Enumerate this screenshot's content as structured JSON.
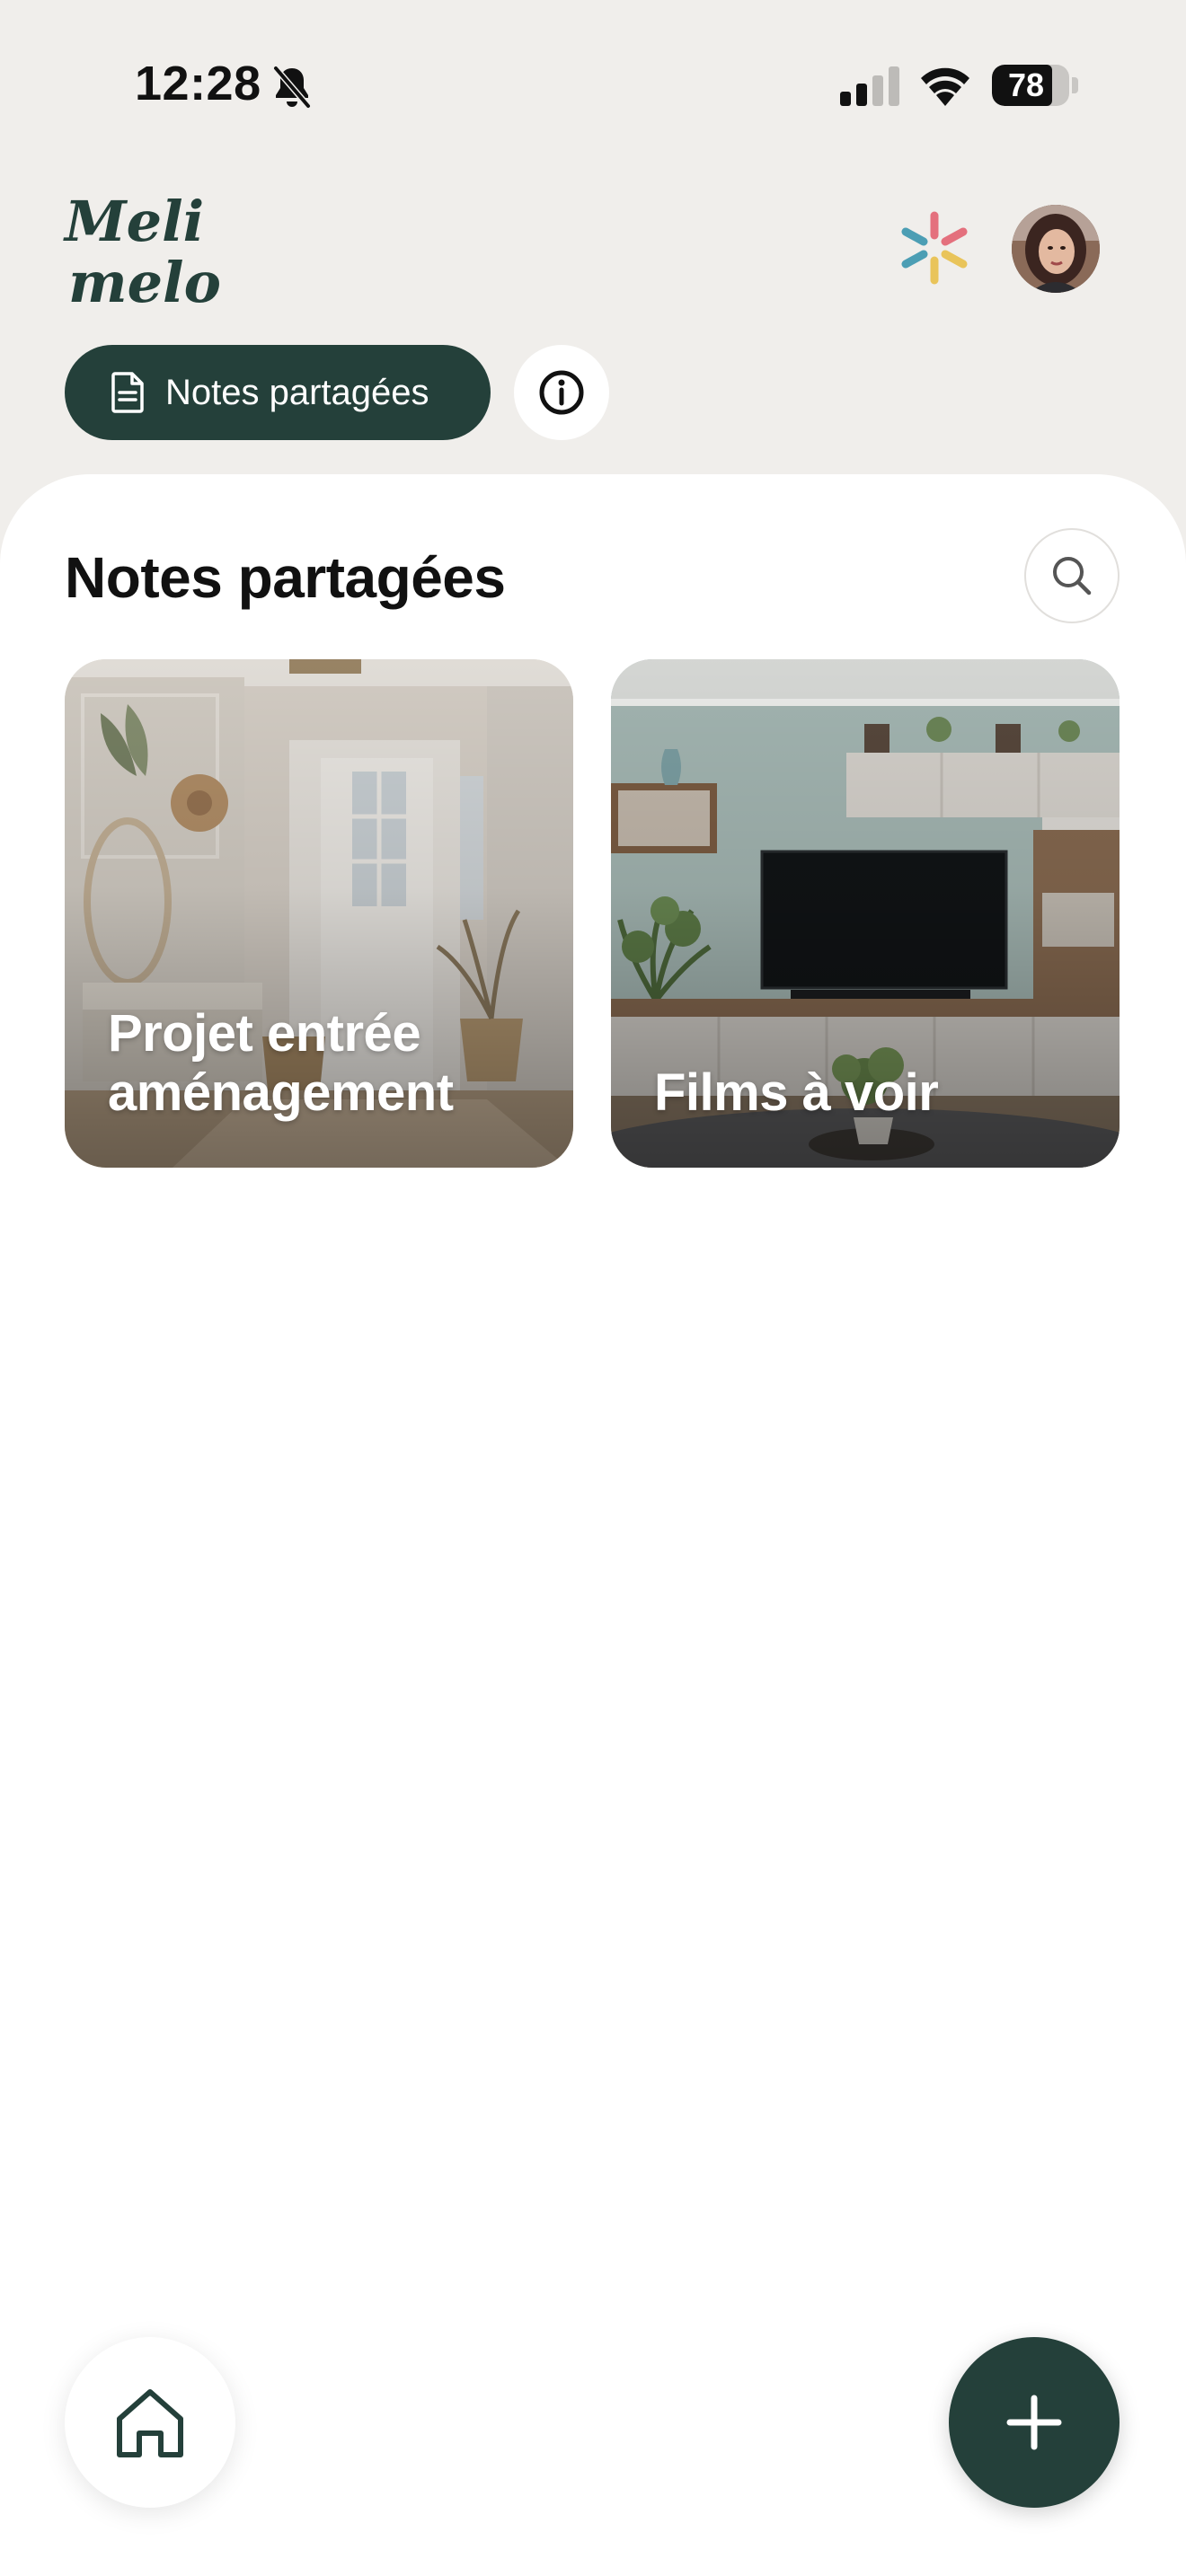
{
  "status_bar": {
    "time": "12:28",
    "silent_icon": "bell-slash-icon",
    "signal_icon": "cellular-signal-icon",
    "wifi_icon": "wifi-icon",
    "battery_percent": "78",
    "battery_level": 0.78
  },
  "header": {
    "logo_line1": "Meli",
    "logo_line2": "melo",
    "sparkle_icon": "sparkle-icon",
    "avatar": "user-avatar",
    "filter_chip": {
      "label": "Notes partagées",
      "icon": "document-icon"
    },
    "info_icon": "info-icon"
  },
  "main": {
    "title": "Notes partagées",
    "search_icon": "search-icon",
    "notes": [
      {
        "title": "Projet entrée aménagement",
        "image": "entryway-photo"
      },
      {
        "title": "Films à voir",
        "image": "living-room-tv-photo"
      }
    ]
  },
  "bottom": {
    "home_icon": "home-icon",
    "add_icon": "plus-icon"
  },
  "colors": {
    "background": "#f0eeeb",
    "accent": "#24403a",
    "sheet": "#ffffff"
  }
}
